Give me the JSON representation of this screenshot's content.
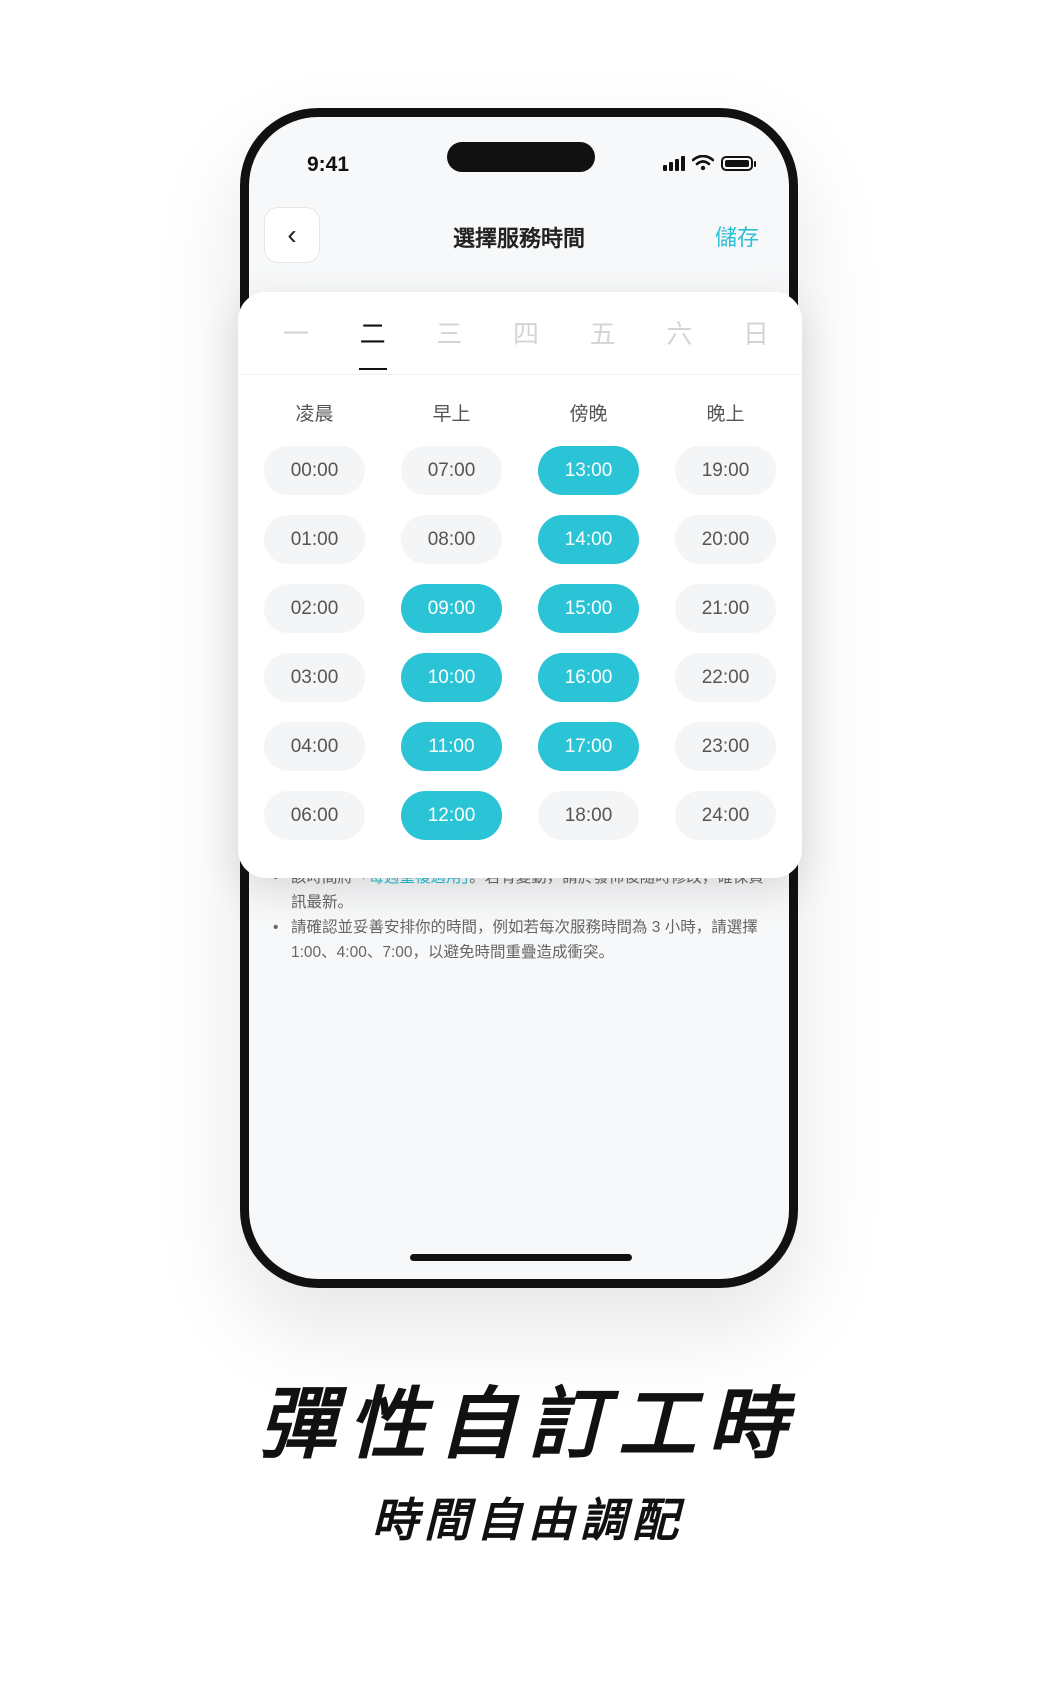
{
  "status_bar": {
    "time": "9:41"
  },
  "nav": {
    "back_icon": "‹",
    "title": "選擇服務時間",
    "save_label": "儲存"
  },
  "day_tabs": [
    {
      "label": "一",
      "active": false
    },
    {
      "label": "二",
      "active": true
    },
    {
      "label": "三",
      "active": false
    },
    {
      "label": "四",
      "active": false
    },
    {
      "label": "五",
      "active": false
    },
    {
      "label": "六",
      "active": false
    },
    {
      "label": "日",
      "active": false
    }
  ],
  "periods": [
    {
      "label": "凌晨",
      "slots": [
        {
          "time": "00:00",
          "selected": false
        },
        {
          "time": "01:00",
          "selected": false
        },
        {
          "time": "02:00",
          "selected": false
        },
        {
          "time": "03:00",
          "selected": false
        },
        {
          "time": "04:00",
          "selected": false
        },
        {
          "time": "06:00",
          "selected": false
        }
      ]
    },
    {
      "label": "早上",
      "slots": [
        {
          "time": "07:00",
          "selected": false
        },
        {
          "time": "08:00",
          "selected": false
        },
        {
          "time": "09:00",
          "selected": true
        },
        {
          "time": "10:00",
          "selected": true
        },
        {
          "time": "11:00",
          "selected": true
        },
        {
          "time": "12:00",
          "selected": true
        }
      ]
    },
    {
      "label": "傍晚",
      "slots": [
        {
          "time": "13:00",
          "selected": true
        },
        {
          "time": "14:00",
          "selected": true
        },
        {
          "time": "15:00",
          "selected": true
        },
        {
          "time": "16:00",
          "selected": true
        },
        {
          "time": "17:00",
          "selected": true
        },
        {
          "time": "18:00",
          "selected": false
        }
      ]
    },
    {
      "label": "晚上",
      "slots": [
        {
          "time": "19:00",
          "selected": false
        },
        {
          "time": "20:00",
          "selected": false
        },
        {
          "time": "21:00",
          "selected": false
        },
        {
          "time": "22:00",
          "selected": false
        },
        {
          "time": "23:00",
          "selected": false
        },
        {
          "time": "24:00",
          "selected": false
        }
      ]
    }
  ],
  "notes": {
    "note1_pre": "該時間將",
    "note1_highlight": "「每週重複適用」",
    "note1_post": "。若有變動，請於發佈後隨時修改，確保資訊最新。",
    "note2": "請確認並妥善安排你的時間，例如若每次服務時間為 3 小時，請選擇 1:00、4:00、7:00，以避免時間重疊造成衝突。"
  },
  "caption": {
    "headline": "彈性自訂工時",
    "subline": "時間自由調配"
  },
  "colors": {
    "accent": "#2bc4d6",
    "slot_bg": "#f4f5f6"
  }
}
